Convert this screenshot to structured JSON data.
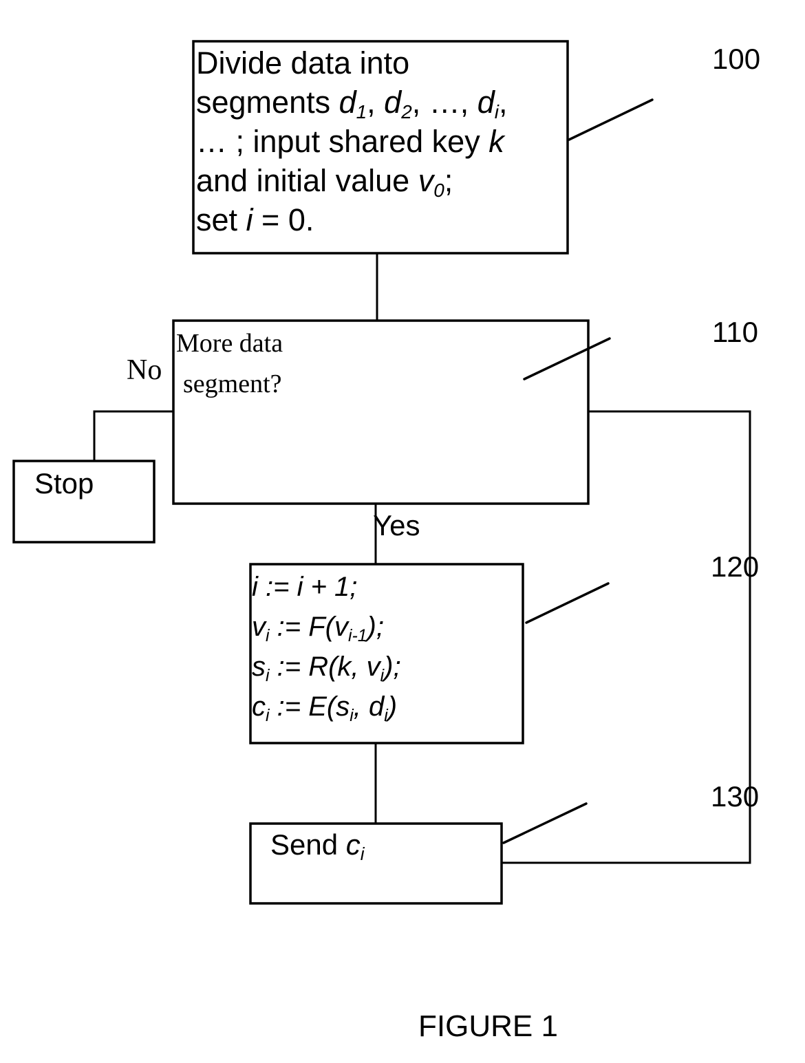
{
  "figure_caption": "FIGURE 1",
  "nodes": {
    "step100": {
      "ref": "100",
      "lines": [
        [
          {
            "t": "Divide data into"
          }
        ],
        [
          {
            "t": "segments "
          },
          {
            "t": "d",
            "i": true
          },
          {
            "t": "1",
            "i": true,
            "sub": true
          },
          {
            "t": ", "
          },
          {
            "t": "d",
            "i": true
          },
          {
            "t": "2",
            "i": true,
            "sub": true
          },
          {
            "t": ", …, "
          },
          {
            "t": "d",
            "i": true
          },
          {
            "t": "i",
            "i": true,
            "sub": true
          },
          {
            "t": ","
          }
        ],
        [
          {
            "t": "… ; input shared key "
          },
          {
            "t": "k",
            "i": true
          }
        ],
        [
          {
            "t": "and initial value "
          },
          {
            "t": "v",
            "i": true
          },
          {
            "t": "0",
            "i": true,
            "sub": true
          },
          {
            "t": ";"
          }
        ],
        [
          {
            "t": "set "
          },
          {
            "t": "i",
            "i": true
          },
          {
            "t": " = 0."
          }
        ]
      ]
    },
    "step110": {
      "ref": "110",
      "lines": [
        "More data",
        "segment?"
      ],
      "no_label": "No",
      "yes_label": "Yes"
    },
    "stop": {
      "label": "Stop"
    },
    "step120": {
      "ref": "120",
      "lines": [
        [
          {
            "t": "i := i + 1;"
          }
        ],
        [
          {
            "t": "v"
          },
          {
            "t": "i",
            "sub": true
          },
          {
            "t": " := F(v"
          },
          {
            "t": "i-1",
            "sub": true
          },
          {
            "t": ");"
          }
        ],
        [
          {
            "t": "s"
          },
          {
            "t": "i",
            "sub": true
          },
          {
            "t": " := R(k, v"
          },
          {
            "t": "i",
            "sub": true
          },
          {
            "t": ");"
          }
        ],
        [
          {
            "t": "c"
          },
          {
            "t": "i",
            "sub": true
          },
          {
            "t": " := E(s"
          },
          {
            "t": "i",
            "sub": true
          },
          {
            "t": ", d"
          },
          {
            "t": "i",
            "sub": true
          },
          {
            "t": ")"
          }
        ]
      ]
    },
    "step130": {
      "ref": "130",
      "label": "Send ",
      "var": "c",
      "var_sub": "i"
    }
  }
}
